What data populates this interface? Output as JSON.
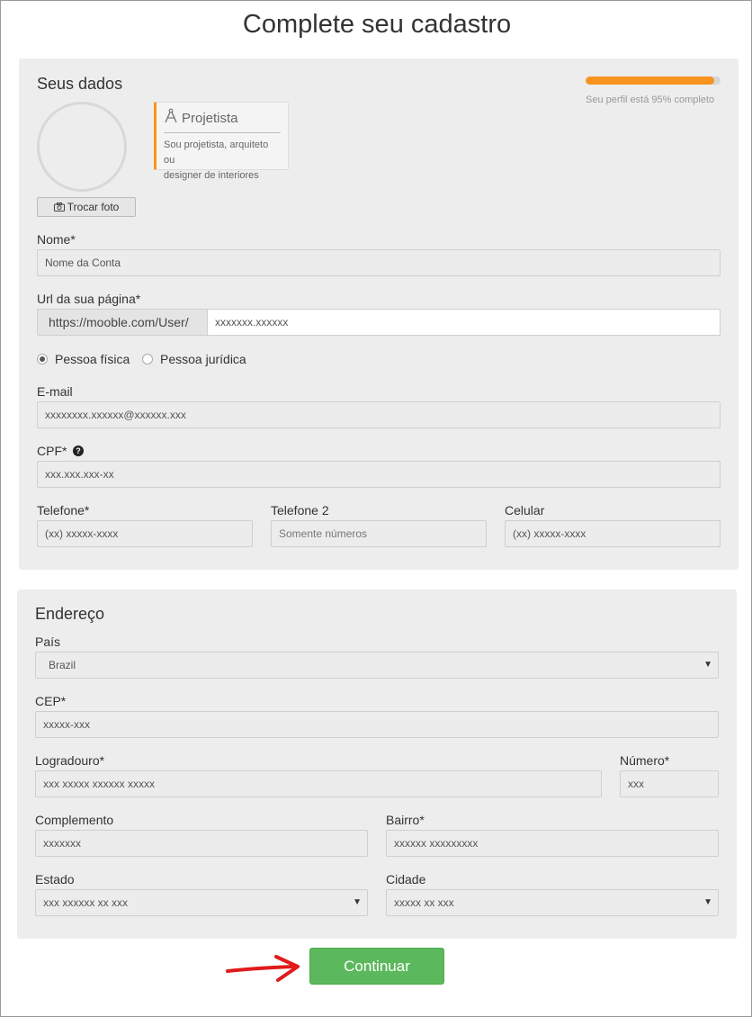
{
  "page": {
    "title": "Complete seu cadastro"
  },
  "dados": {
    "section_title": "Seus dados",
    "progress": {
      "percent": 95,
      "text": "Seu perfil está 95% completo",
      "color": "#f7931e"
    },
    "photo_button": "Trocar foto",
    "role": {
      "title": "Projetista",
      "description_line1": "Sou projetista, arquiteto ou",
      "description_line2": "designer de interiores"
    },
    "nome": {
      "label": "Nome*",
      "value": "Nome da Conta"
    },
    "url": {
      "label": "Url da sua página*",
      "prefix": "https://mooble.com/User/",
      "value": "xxxxxxx.xxxxxx"
    },
    "pessoa": {
      "fisica": "Pessoa física",
      "juridica": "Pessoa jurídica",
      "selected": "fisica"
    },
    "email": {
      "label": "E-mail",
      "value": "xxxxxxxx.xxxxxx@xxxxxx.xxx"
    },
    "cpf": {
      "label": "CPF*",
      "value": "xxx.xxx.xxx-xx"
    },
    "telefone": {
      "label": "Telefone*",
      "value": "(xx) xxxxx-xxxx"
    },
    "telefone2": {
      "label": "Telefone 2",
      "placeholder": "Somente números"
    },
    "celular": {
      "label": "Celular",
      "value": "(xx) xxxxx-xxxx"
    }
  },
  "endereco": {
    "section_title": "Endereço",
    "pais": {
      "label": "País",
      "value": "Brazil"
    },
    "cep": {
      "label": "CEP*",
      "value": "xxxxx-xxx"
    },
    "logradouro": {
      "label": "Logradouro*",
      "value": "xxx xxxxx xxxxxx xxxxx"
    },
    "numero": {
      "label": "Número*",
      "value": "xxx"
    },
    "complemento": {
      "label": "Complemento",
      "value": "xxxxxxx"
    },
    "bairro": {
      "label": "Bairro*",
      "value": "xxxxxx xxxxxxxxx"
    },
    "estado": {
      "label": "Estado",
      "value": "xxx xxxxxx xx xxx"
    },
    "cidade": {
      "label": "Cidade",
      "value": "xxxxx xx xxx"
    }
  },
  "actions": {
    "continue_label": "Continuar",
    "primary_color": "#5cb85c",
    "arrow_color": "#e01b1b"
  }
}
